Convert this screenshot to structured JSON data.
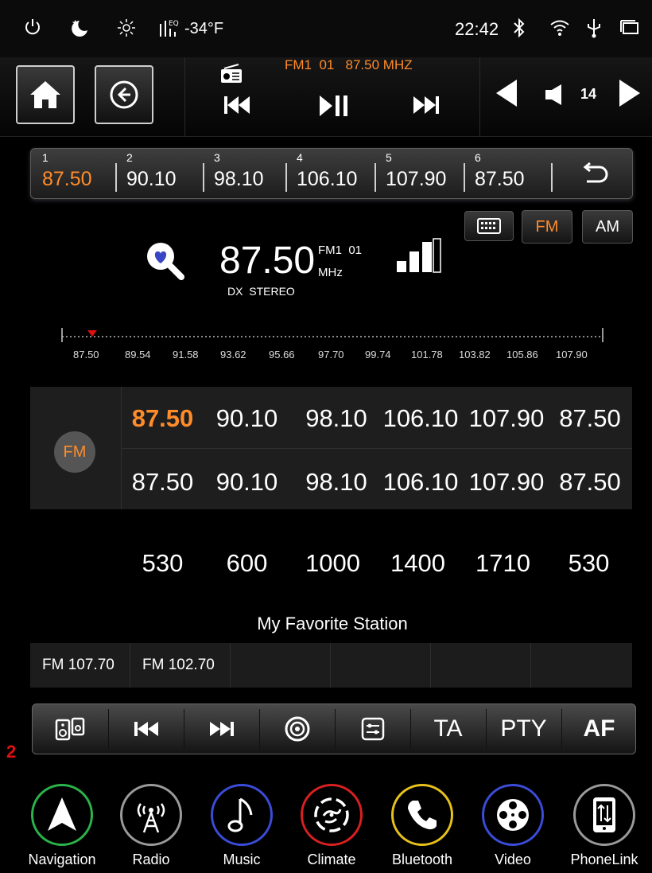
{
  "status": {
    "temperature": "-34°F",
    "time": "22:42",
    "eq_label": "EQ",
    "icons": [
      "power-icon",
      "night-mode-icon",
      "brightness-icon",
      "equalizer-icon",
      "bluetooth-icon",
      "wifi-icon",
      "usb-icon",
      "window-icon"
    ]
  },
  "topbar": {
    "station_info": "FM1  01   87.50 MHZ",
    "volume": "14"
  },
  "presets": [
    {
      "num": "1",
      "freq": "87.50",
      "active": true
    },
    {
      "num": "2",
      "freq": "90.10"
    },
    {
      "num": "3",
      "freq": "98.10"
    },
    {
      "num": "4",
      "freq": "106.10"
    },
    {
      "num": "5",
      "freq": "107.90"
    },
    {
      "num": "6",
      "freq": "87.50"
    }
  ],
  "mode_buttons": {
    "fm": "FM",
    "am": "AM"
  },
  "tuner": {
    "frequency": "87.50",
    "band_preset": "FM1  01",
    "unit": "MHz",
    "stereo": "DX  STEREO"
  },
  "scale_ticks": [
    "87.50",
    "89.54",
    "91.58",
    "93.62",
    "95.66",
    "97.70",
    "99.74",
    "101.78",
    "103.82",
    "105.86",
    "107.90"
  ],
  "fm_grid": {
    "band_label": "FM",
    "row1": [
      "87.50",
      "90.10",
      "98.10",
      "106.10",
      "107.90",
      "87.50"
    ],
    "row2": [
      "87.50",
      "90.10",
      "98.10",
      "106.10",
      "107.90",
      "87.50"
    ]
  },
  "am_row": [
    "530",
    "600",
    "1000",
    "1400",
    "1710",
    "530"
  ],
  "favorites": {
    "title": "My Favorite Station",
    "items": [
      "FM 107.70",
      "FM 102.70",
      "",
      "",
      "",
      ""
    ]
  },
  "bottom_bar": {
    "ta": "TA",
    "pty": "PTY",
    "af": "AF"
  },
  "page_marker": "2",
  "dock": [
    {
      "label": "Navigation",
      "color": "#2bb34a"
    },
    {
      "label": "Radio",
      "color": "#9a9a9a"
    },
    {
      "label": "Music",
      "color": "#3a4cd8"
    },
    {
      "label": "Climate",
      "color": "#d82020"
    },
    {
      "label": "Bluetooth",
      "color": "#e6c21a"
    },
    {
      "label": "Video",
      "color": "#3a4cd8"
    },
    {
      "label": "PhoneLink",
      "color": "#9a9a9a"
    }
  ],
  "colors": {
    "accent": "#ff8c2a",
    "marker": "#e01010"
  }
}
